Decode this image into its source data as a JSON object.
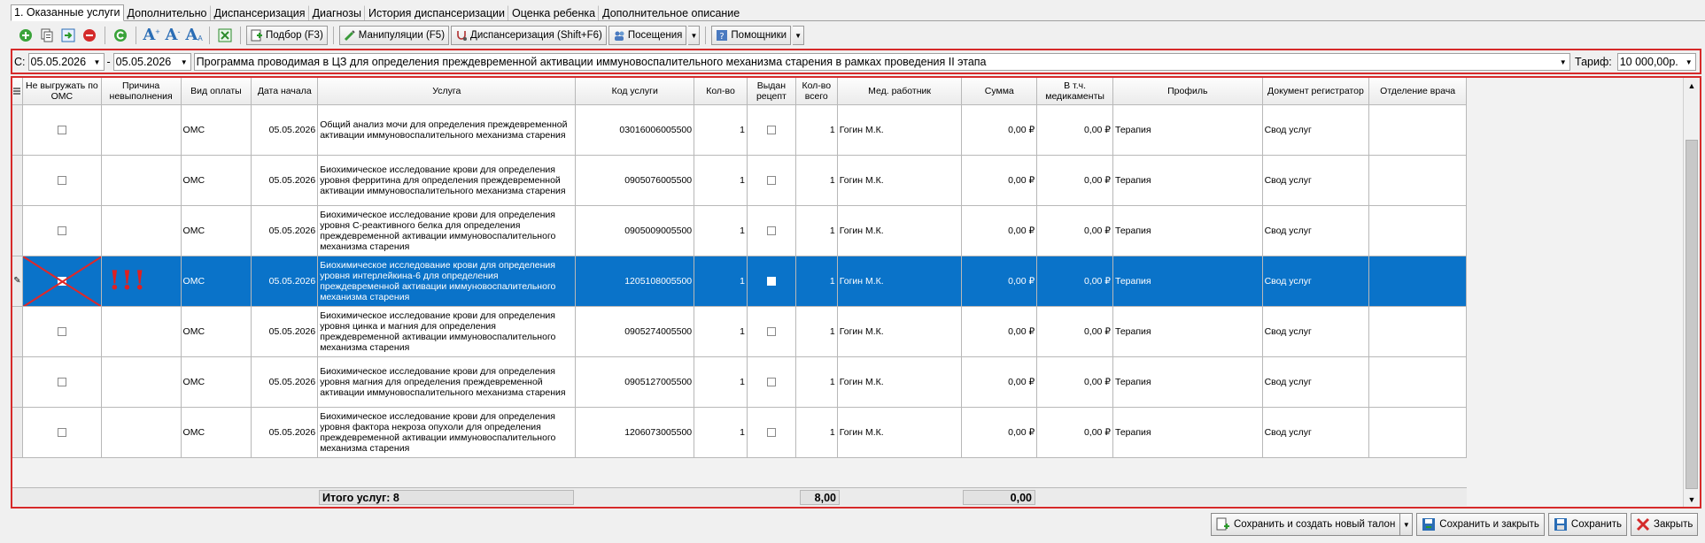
{
  "tabs": [
    {
      "label": "1. Оказанные услуги",
      "active": true
    },
    {
      "label": "Дополнительно"
    },
    {
      "label": "Диспансеризация"
    },
    {
      "label": "Диагнозы"
    },
    {
      "label": "История диспансеризации"
    },
    {
      "label": "Оценка ребенка"
    },
    {
      "label": "Дополнительное описание"
    }
  ],
  "toolbar": {
    "podbor": "Подбор (F3)",
    "manipulations": "Манипуляции (F5)",
    "dispanserization": "Диспансеризация (Shift+F6)",
    "visits": "Посещения",
    "helpers": "Помощники"
  },
  "filter": {
    "from_label": "С:",
    "date_from": "05.05.2026",
    "dash": "-",
    "date_to": "05.05.2026",
    "program": "Программа проводимая в ЦЗ для определения преждевременной активации иммуновоспалительного механизма старения в рамках проведения II этапа",
    "tarif_label": "Тариф:",
    "tarif_value": "10 000,00р."
  },
  "grid": {
    "headers": {
      "noexport": "Не выгружать по ОМС",
      "reason": "Причина невыполнения",
      "pay": "Вид оплаты",
      "date": "Дата начала",
      "service": "Услуга",
      "code": "Код услуги",
      "qty": "Кол-во",
      "recipe": "Выдан рецепт",
      "qtyall": "Кол-во всего",
      "doctor": "Мед. работник",
      "sum": "Сумма",
      "med": "В т.ч. медикаменты",
      "profile": "Профиль",
      "registrar": "Документ регистратор",
      "dept": "Отделение врача"
    },
    "rows": [
      {
        "pay": "ОМС",
        "date": "05.05.2026",
        "service": "Общий анализ мочи для определения преждевременной активации иммуновоспалительного механизма старения",
        "code": "03016006005500",
        "qty": "1",
        "qtyall": "1",
        "doctor": "Гогин М.К.",
        "sum": "0,00 ₽",
        "med": "0,00 ₽",
        "profile": "Терапия",
        "registrar": "Свод услуг",
        "dept": "",
        "reason": "",
        "selected": false
      },
      {
        "pay": "ОМС",
        "date": "05.05.2026",
        "service": "Биохимическое исследование крови для определения уровня ферритина для определения преждевременной активации иммуновоспалительного механизма старения",
        "code": "0905076005500",
        "qty": "1",
        "qtyall": "1",
        "doctor": "Гогин М.К.",
        "sum": "0,00 ₽",
        "med": "0,00 ₽",
        "profile": "Терапия",
        "registrar": "Свод услуг",
        "dept": "",
        "reason": "",
        "selected": false
      },
      {
        "pay": "ОМС",
        "date": "05.05.2026",
        "service": "Биохимическое исследование крови для определения уровня С-реактивного белка для определения преждевременной активации иммуновоспалительного механизма старения",
        "code": "0905009005500",
        "qty": "1",
        "qtyall": "1",
        "doctor": "Гогин М.К.",
        "sum": "0,00 ₽",
        "med": "0,00 ₽",
        "profile": "Терапия",
        "registrar": "Свод услуг",
        "dept": "",
        "reason": "",
        "selected": false
      },
      {
        "pay": "ОМС",
        "date": "05.05.2026",
        "service": "Биохимическое исследование крови для определения уровня интерлейкина-6 для определения преждевременной активации иммуновоспалительного механизма старения",
        "code": "1205108005500",
        "qty": "1",
        "qtyall": "1",
        "doctor": "Гогин М.К.",
        "sum": "0,00 ₽",
        "med": "0,00 ₽",
        "profile": "Терапия",
        "registrar": "Свод услуг",
        "dept": "",
        "reason": "!!!",
        "selected": true
      },
      {
        "pay": "ОМС",
        "date": "05.05.2026",
        "service": "Биохимическое исследование крови для определения уровня цинка и магния для определения преждевременной активации иммуновоспалительного механизма старения",
        "code": "0905274005500",
        "qty": "1",
        "qtyall": "1",
        "doctor": "Гогин М.К.",
        "sum": "0,00 ₽",
        "med": "0,00 ₽",
        "profile": "Терапия",
        "registrar": "Свод услуг",
        "dept": "",
        "reason": "",
        "selected": false
      },
      {
        "pay": "ОМС",
        "date": "05.05.2026",
        "service": "Биохимическое исследование крови для определения уровня магния для определения преждевременной активации иммуновоспалительного механизма старения",
        "code": "0905127005500",
        "qty": "1",
        "qtyall": "1",
        "doctor": "Гогин М.К.",
        "sum": "0,00 ₽",
        "med": "0,00 ₽",
        "profile": "Терапия",
        "registrar": "Свод услуг",
        "dept": "",
        "reason": "",
        "selected": false
      },
      {
        "pay": "ОМС",
        "date": "05.05.2026",
        "service": "Биохимическое исследование крови для определения уровня фактора некроза опухоли для определения преждевременной активации иммуновоспалительного механизма старения",
        "code": "1206073005500",
        "qty": "1",
        "qtyall": "1",
        "doctor": "Гогин М.К.",
        "sum": "0,00 ₽",
        "med": "0,00 ₽",
        "profile": "Терапия",
        "registrar": "Свод услуг",
        "dept": "",
        "reason": "",
        "selected": false
      }
    ],
    "totals": {
      "label": "Итого услуг: 8",
      "qty": "8,00",
      "sum": "0,00"
    }
  },
  "buttons": {
    "save_new": "Сохранить и создать новый талон",
    "save_close": "Сохранить и закрыть",
    "save": "Сохранить",
    "close": "Закрыть"
  },
  "colors": {
    "highlight": "#d62a2a",
    "selection": "#0a73c9"
  }
}
